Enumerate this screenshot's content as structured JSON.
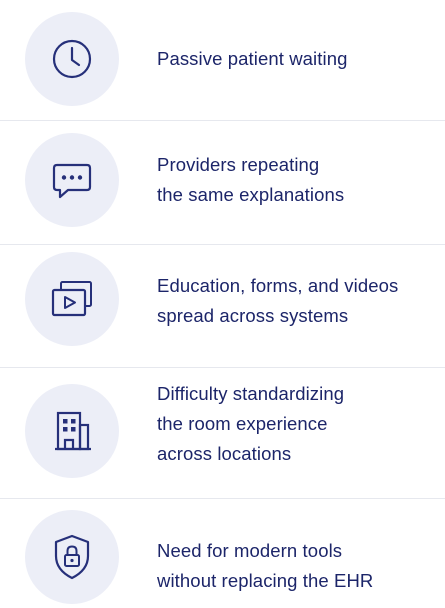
{
  "items": [
    {
      "icon": "clock-icon",
      "lines": [
        "Passive patient waiting"
      ]
    },
    {
      "icon": "chat-bubble-icon",
      "lines": [
        "Providers repeating",
        "the same explanations"
      ]
    },
    {
      "icon": "video-stack-icon",
      "lines": [
        "Education, forms, and videos",
        "spread across systems"
      ]
    },
    {
      "icon": "building-icon",
      "lines": [
        "Difficulty standardizing",
        "the room experience",
        "across locations"
      ]
    },
    {
      "icon": "shield-lock-icon",
      "lines": [
        "Need for modern tools",
        "without replacing the EHR"
      ]
    }
  ],
  "colors": {
    "text": "#1c2569",
    "icon_stroke": "#26307a",
    "icon_circle": "#eceef7",
    "divider": "#e6e8ee"
  }
}
